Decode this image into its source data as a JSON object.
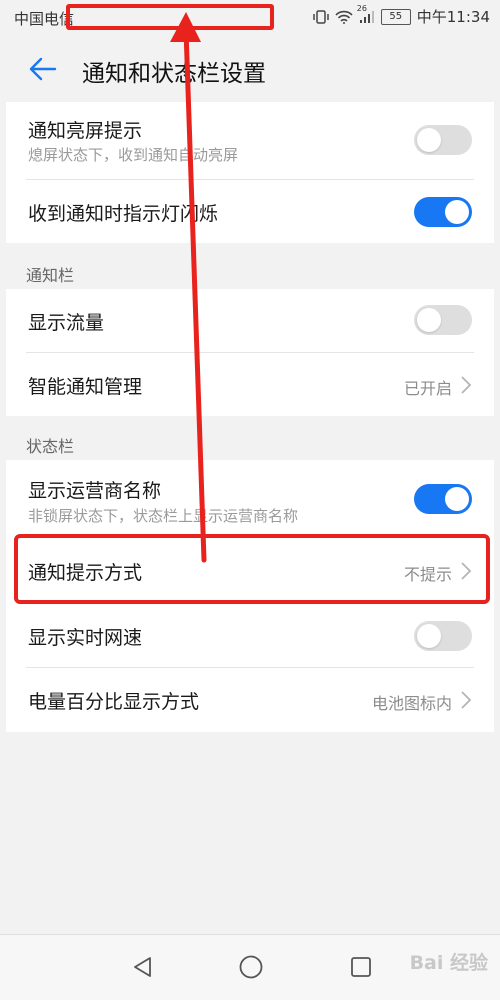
{
  "status_bar": {
    "carrier": "中国电信",
    "network": "26",
    "battery": "55",
    "time": "中午11:34"
  },
  "header": {
    "title": "通知和状态栏设置"
  },
  "settings": {
    "screen_on": {
      "label": "通知亮屏提示",
      "description": "熄屏状态下，收到通知自动亮屏",
      "enabled": false
    },
    "led_blink": {
      "label": "收到通知时指示灯闪烁",
      "enabled": true
    }
  },
  "notification_bar": {
    "section_title": "通知栏",
    "show_traffic": {
      "label": "显示流量",
      "enabled": false
    },
    "smart_management": {
      "label": "智能通知管理",
      "value": "已开启"
    }
  },
  "status_section": {
    "section_title": "状态栏",
    "carrier_name": {
      "label": "显示运营商名称",
      "description": "非锁屏状态下，状态栏上显示运营商名称",
      "enabled": true
    },
    "notify_style": {
      "label": "通知提示方式",
      "value": "不提示"
    },
    "realtime_speed": {
      "label": "显示实时网速",
      "enabled": false
    },
    "battery_percent": {
      "label": "电量百分比显示方式",
      "value": "电池图标内"
    }
  },
  "watermark": {
    "text": "Bai 经验"
  },
  "colors": {
    "accent": "#1877f2",
    "annotation": "#e8231e",
    "background": "#f2f2f2"
  }
}
